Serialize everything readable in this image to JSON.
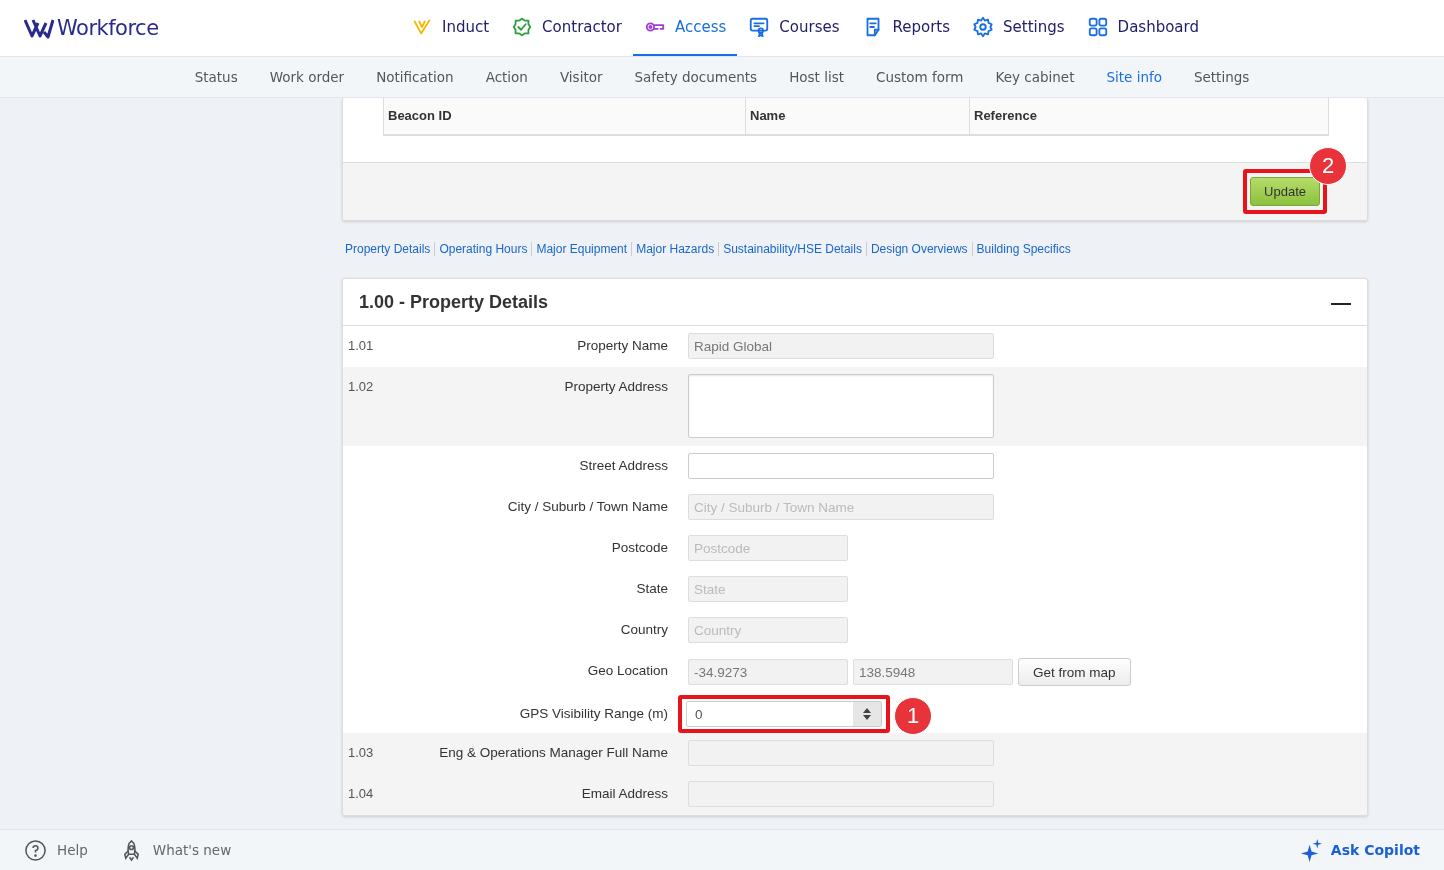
{
  "brand": {
    "name": "Workforce"
  },
  "nav": [
    {
      "label": "Induct",
      "color": "#f5b800",
      "selected": false
    },
    {
      "label": "Contractor",
      "color": "#2e9e3e",
      "selected": false
    },
    {
      "label": "Access",
      "color": "#a040d0",
      "selected": true
    },
    {
      "label": "Courses",
      "color": "#1a6fe0",
      "selected": false
    },
    {
      "label": "Reports",
      "color": "#1a6fe0",
      "selected": false
    },
    {
      "label": "Settings",
      "color": "#1a6fe0",
      "selected": false
    },
    {
      "label": "Dashboard",
      "color": "#1a6fe0",
      "selected": false
    }
  ],
  "subnav": [
    {
      "label": "Status",
      "selected": false
    },
    {
      "label": "Work order",
      "selected": false
    },
    {
      "label": "Notification",
      "selected": false
    },
    {
      "label": "Action",
      "selected": false
    },
    {
      "label": "Visitor",
      "selected": false
    },
    {
      "label": "Safety documents",
      "selected": false
    },
    {
      "label": "Host list",
      "selected": false
    },
    {
      "label": "Custom form",
      "selected": false
    },
    {
      "label": "Key cabinet",
      "selected": false
    },
    {
      "label": "Site info",
      "selected": true
    },
    {
      "label": "Settings",
      "selected": false
    }
  ],
  "beacon_table": {
    "columns": [
      "Beacon ID",
      "Name",
      "Reference"
    ]
  },
  "update_button": {
    "label": "Update",
    "callout": "2"
  },
  "section_links": [
    "Property Details",
    "Operating Hours",
    "Major Equipment",
    "Major Hazards",
    "Sustainability/HSE Details",
    "Design Overviews",
    "Building Specifics"
  ],
  "section": {
    "title": "1.00 - Property Details",
    "collapse_icon": "—",
    "rows": [
      {
        "number": "1.01",
        "label": "Property Name",
        "fields": [
          {
            "kind": "wide",
            "value": "Rapid Global",
            "disabled": true
          }
        ]
      },
      {
        "number": "1.02",
        "label": "Property Address",
        "fields": [
          {
            "kind": "textarea",
            "disabled": false
          }
        ]
      },
      {
        "label": "Street Address",
        "fields": [
          {
            "kind": "wide",
            "disabled": false
          }
        ]
      },
      {
        "label": "City / Suburb / Town Name",
        "fields": [
          {
            "kind": "wide",
            "placeholder": "City / Suburb / Town Name",
            "disabled": true
          }
        ]
      },
      {
        "label": "Postcode",
        "fields": [
          {
            "kind": "narrow",
            "placeholder": "Postcode",
            "disabled": true
          }
        ]
      },
      {
        "label": "State",
        "fields": [
          {
            "kind": "narrow",
            "placeholder": "State",
            "disabled": true
          }
        ]
      },
      {
        "label": "Country",
        "fields": [
          {
            "kind": "narrow",
            "placeholder": "Country",
            "disabled": true
          }
        ]
      },
      {
        "label": "Geo Location",
        "fields": [
          {
            "kind": "narrow",
            "value": "-34.9273",
            "disabled": true
          },
          {
            "kind": "narrow",
            "value": "138.5948",
            "disabled": true
          },
          {
            "kind": "button",
            "label": "Get from map"
          }
        ]
      },
      {
        "label": "GPS Visibility Range (m)",
        "fields": [
          {
            "kind": "spinner",
            "value": "0",
            "callout": "1",
            "disabled": false
          }
        ]
      },
      {
        "number": "1.03",
        "label": "Eng & Operations Manager Full Name",
        "fields": [
          {
            "kind": "wide",
            "disabled": true
          }
        ]
      },
      {
        "number": "1.04",
        "label": "Email Address",
        "fields": [
          {
            "kind": "wide",
            "disabled": true
          }
        ]
      }
    ]
  },
  "footer": {
    "help": "Help",
    "whats_new": "What's new",
    "copilot": "Ask Copilot"
  }
}
